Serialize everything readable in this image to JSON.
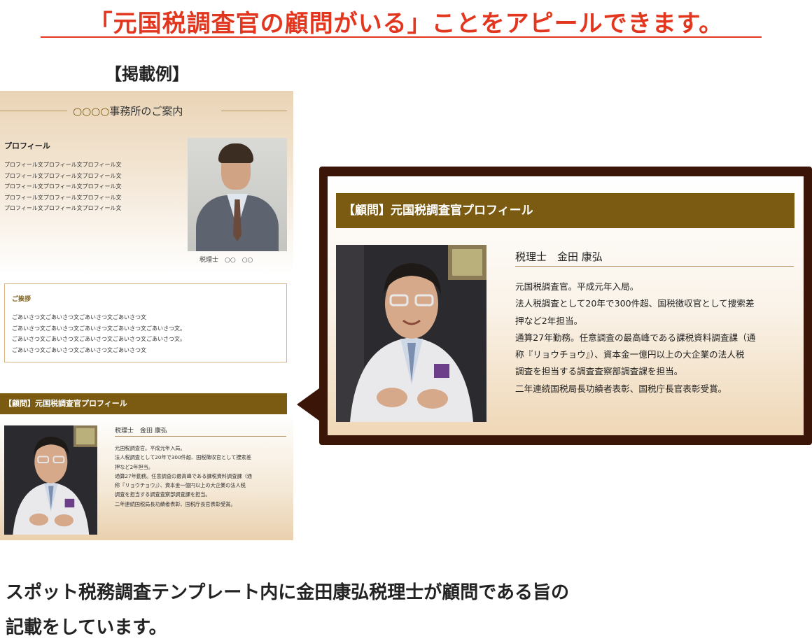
{
  "headline": "「元国税調査官の顧問がいる」ことをアピールできます。",
  "example_label": "【掲載例】",
  "sample": {
    "office_mark": "○○○○",
    "office_title": "事務所のご案内",
    "profile_heading": "プロフィール",
    "profile_lines": [
      "プロフィール文プロフィール文プロフィール文",
      "プロフィール文プロフィール文プロフィール文",
      "プロフィール文プロフィール文プロフィール文",
      "プロフィール文プロフィール文プロフィール文",
      "プロフィール文プロフィール文プロフィール文"
    ],
    "portrait_caption": "税理士　○○　○○",
    "greeting_heading": "ご挨拶",
    "greeting_lines": [
      "ごあいさつ文ごあいさつ文ごあいさつ文ごあいさつ文",
      "ごあいさつ文ごあいさつ文ごあいさつ文ごあいさつ文ごあいさつ文。",
      "ごあいさつ文ごあいさつ文ごあいさつ文ごあいさつ文ごあいさつ文。",
      "ごあいさつ文ごあいさつ文ごあいさつ文ごあいさつ文"
    ]
  },
  "advisor": {
    "bar_title": "【顧問】元国税調査官プロフィール",
    "name": "税理士　金田 康弘",
    "lines_big": [
      "元国税調査官。平成元年入局。",
      "法人税調査として20年で300件超、国税徴収官として捜索差",
      "押など2年担当。",
      "通算27年勤務。任意調査の最高峰である課税資料調査課（通",
      "称『リョウチョウ』）、資本金一億円以上の大企業の法人税",
      "調査を担当する調査査察部調査課を担当。",
      "二年連続国税局長功績者表彰、国税庁長官表彰受賞。"
    ],
    "lines_small": [
      "元国税調査官。平成元年入局。",
      "法人税調査として20年で300件超、国税徴収官として捜索差",
      "押など2年担当。",
      "通算27年勤務。任意調査の最高峰である課税資料調査課（通",
      "称『リョウチョウ』）、資本金一億円以上の大企業の法人税",
      "調査を担当する調査査察部調査課を担当。",
      "二年連続国税局長功績者表彰、国税庁長官表彰受賞。"
    ]
  },
  "footer_lines": [
    "スポット税務調査テンプレート内に金田康弘税理士が顧問である旨の",
    "記載をしています。"
  ],
  "colors": {
    "accent_red": "#e2361f",
    "bar_brown": "#7b5b12",
    "callout_dark": "#3a1508"
  }
}
